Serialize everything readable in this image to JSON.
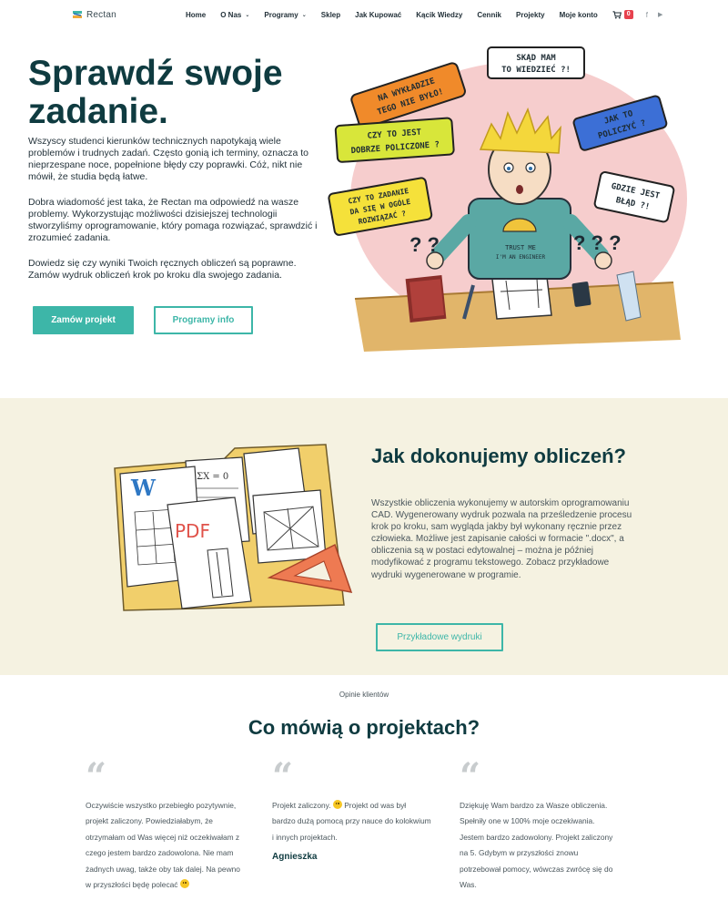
{
  "brand": {
    "name": "Rectan"
  },
  "nav": {
    "items": [
      {
        "label": "Home",
        "has_dropdown": false
      },
      {
        "label": "O Nas",
        "has_dropdown": true
      },
      {
        "label": "Programy",
        "has_dropdown": true
      },
      {
        "label": "Sklep",
        "has_dropdown": false
      },
      {
        "label": "Jak Kupować",
        "has_dropdown": false
      },
      {
        "label": "Kącik Wiedzy",
        "has_dropdown": false
      },
      {
        "label": "Cennik",
        "has_dropdown": false
      },
      {
        "label": "Projekty",
        "has_dropdown": false
      },
      {
        "label": "Moje konto",
        "has_dropdown": false
      }
    ],
    "cart_count": "0",
    "social": [
      "f",
      "▶"
    ]
  },
  "hero": {
    "title": "Sprawdź swoje zadanie.",
    "paragraphs": [
      "Wszyscy studenci kierunków technicznych napotykają wiele problemów i trudnych zadań. Często gonią ich terminy, oznacza to nieprzespane noce, popełnione błędy czy poprawki. Cóż, nikt nie mówił, że studia będą łatwe.",
      "Dobra wiadomość jest taka, że Rectan ma odpowiedź na wasze problemy. Wykorzystując możliwości dzisiejszej technologii stworzyliśmy oprogramowanie, który pomaga rozwiązać, sprawdzić i zrozumieć zadania.",
      "Dowiedz się czy wyniki Twoich ręcznych obliczeń są poprawne. Zamów wydruk obliczeń krok po kroku dla swojego zadania."
    ],
    "primary_button": "Zamów projekt",
    "secondary_button": "Programy info",
    "illustration": {
      "bubbles": [
        "NA WYKŁADZIE TEGO NIE BYŁO!",
        "SKĄD MAM TO WIEDZIEĆ ?!",
        "CZY TO JEST DOBRZE POLICZONE ?",
        "JAK TO POLICZYĆ ?",
        "GDZIE JEST BŁĄD ?!",
        "CZY TO ZADANIE DA SIĘ W OGÓLE ROZWIĄZAĆ ?"
      ],
      "shirt_text": "TRUST ME I'M AN ENGINEER"
    }
  },
  "calc_section": {
    "title": "Jak dokonujemy obliczeń?",
    "paragraph": "Wszystkie obliczenia wykonujemy w autorskim oprogramowaniu CAD. Wygenerowany wydruk pozwala na prześledzenie procesu krok po kroku, sam wygląda jakby był wykonany ręcznie przez człowieka. Możliwe jest zapisanie całości w formacie \".docx\", a obliczenia są w postaci edytowalnej – można je później modyfikować z programu tekstowego. Zobacz przykładowe wydruki wygenerowane w programie.",
    "button": "Przykładowe wydruki",
    "illustration": {
      "word_letter": "W",
      "pdf_label": "PDF"
    }
  },
  "testimonials": {
    "eyebrow": "Opinie klientów",
    "title": "Co mówią o projektach?",
    "items": [
      {
        "quote": "Oczywiście wszystko przebiegło pozytywnie, projekt zaliczony. Powiedziałabym, że otrzymałam od Was więcej niż oczekiwałam z czego jestem bardzo zadowolona. Nie mam żadnych uwag, także oby tak dalej. Na pewno w przyszłości będę polecać",
        "has_smile": true,
        "name": ""
      },
      {
        "quote_before": "Projekt zaliczony.",
        "quote_after": "Projekt od was był bardzo dużą pomocą przy nauce do kolokwium i innych projektach.",
        "name": "Agnieszka"
      },
      {
        "quote": "Dziękuję Wam bardzo za Wasze obliczenia. Spełniły one w 100% moje oczekiwania. Jestem bardzo zadowolony. Projekt zaliczony na 5. Gdybym w przyszłości znowu potrzebował pomocy, wówczas zwrócę się do Was.",
        "name": ""
      }
    ]
  },
  "colors": {
    "teal": "#3db6a8",
    "dark_teal": "#0f3b40",
    "beige": "#f5f2e1",
    "badge_red": "#e7424e"
  }
}
